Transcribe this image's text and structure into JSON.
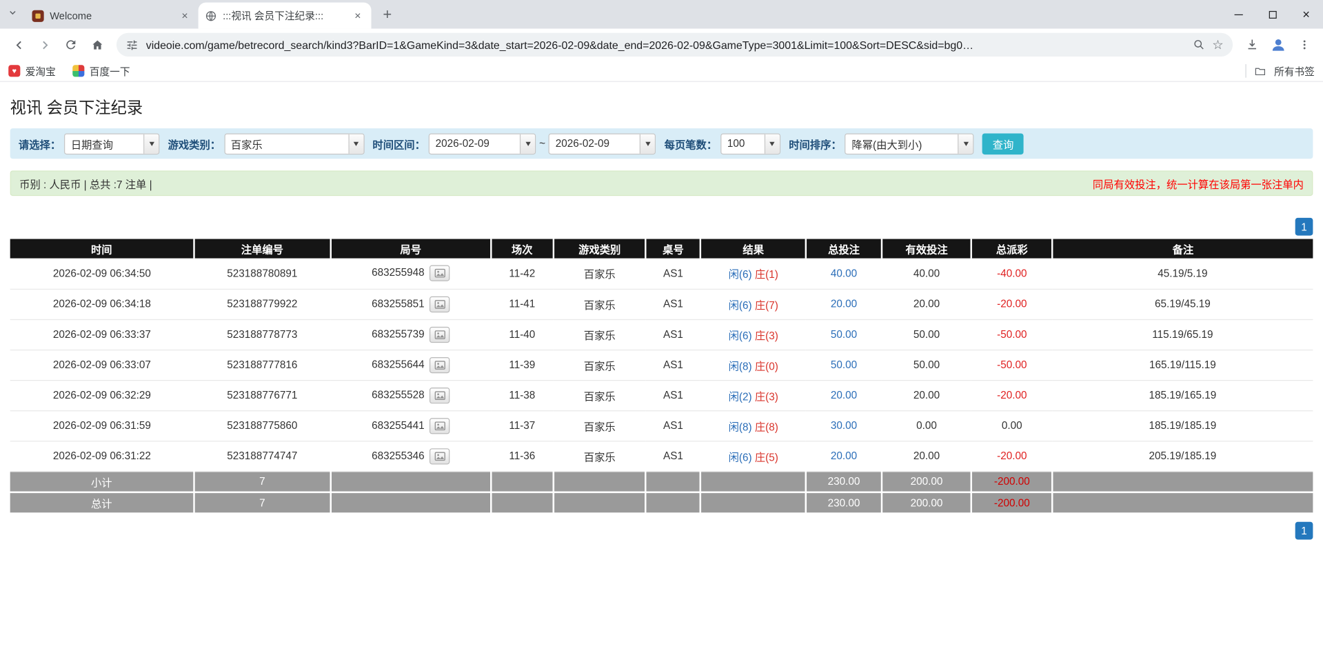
{
  "icons": {
    "close_glyph": "×",
    "plus_glyph": "+",
    "star_glyph": "☆",
    "heart_glyph": "♥"
  },
  "browser": {
    "tabs": [
      {
        "title": "Welcome"
      },
      {
        "title": ":::视讯 会员下注纪录:::"
      }
    ],
    "url": "videoie.com/game/betrecord_search/kind3?BarID=1&GameKind=3&date_start=2026-02-09&date_end=2026-02-09&GameType=3001&Limit=100&Sort=DESC&sid=bg0…",
    "bookmarks": [
      {
        "label": "爱淘宝"
      },
      {
        "label": "百度一下"
      }
    ],
    "all_bookmarks_label": "所有书签"
  },
  "page": {
    "title": "视讯 会员下注纪录",
    "filters": {
      "select_label": "请选择：",
      "select_value": "日期查询",
      "game_label": "游戏类别：",
      "game_value": "百家乐",
      "range_label": "时间区间：",
      "date_start": "2026-02-09",
      "range_separator": "~",
      "date_end": "2026-02-09",
      "per_page_label": "每页笔数：",
      "per_page_value": "100",
      "sort_label": "时间排序：",
      "sort_value": "降幂(由大到小)",
      "search_button": "查询"
    },
    "info_bar": {
      "left": "币别 : 人民币 | 总共 :7 注单 |",
      "right": "同局有效投注，统一计算在该局第一张注单内"
    },
    "pagination": "1",
    "table": {
      "headers": [
        "时间",
        "注单编号",
        "局号",
        "场次",
        "游戏类别",
        "桌号",
        "结果",
        "总投注",
        "有效投注",
        "总派彩",
        "备注"
      ],
      "rows": [
        {
          "time": "2026-02-09 06:34:50",
          "bet_id": "523188780891",
          "round": "683255948",
          "session": "11-42",
          "game": "百家乐",
          "table_no": "AS1",
          "result_player": "闲(6)",
          "result_banker": "庄(1)",
          "total_bet": "40.00",
          "valid_bet": "40.00",
          "payout": "-40.00",
          "remark": "45.19/5.19"
        },
        {
          "time": "2026-02-09 06:34:18",
          "bet_id": "523188779922",
          "round": "683255851",
          "session": "11-41",
          "game": "百家乐",
          "table_no": "AS1",
          "result_player": "闲(6)",
          "result_banker": "庄(7)",
          "total_bet": "20.00",
          "valid_bet": "20.00",
          "payout": "-20.00",
          "remark": "65.19/45.19"
        },
        {
          "time": "2026-02-09 06:33:37",
          "bet_id": "523188778773",
          "round": "683255739",
          "session": "11-40",
          "game": "百家乐",
          "table_no": "AS1",
          "result_player": "闲(6)",
          "result_banker": "庄(3)",
          "total_bet": "50.00",
          "valid_bet": "50.00",
          "payout": "-50.00",
          "remark": "115.19/65.19"
        },
        {
          "time": "2026-02-09 06:33:07",
          "bet_id": "523188777816",
          "round": "683255644",
          "session": "11-39",
          "game": "百家乐",
          "table_no": "AS1",
          "result_player": "闲(8)",
          "result_banker": "庄(0)",
          "total_bet": "50.00",
          "valid_bet": "50.00",
          "payout": "-50.00",
          "remark": "165.19/115.19"
        },
        {
          "time": "2026-02-09 06:32:29",
          "bet_id": "523188776771",
          "round": "683255528",
          "session": "11-38",
          "game": "百家乐",
          "table_no": "AS1",
          "result_player": "闲(2)",
          "result_banker": "庄(3)",
          "total_bet": "20.00",
          "valid_bet": "20.00",
          "payout": "-20.00",
          "remark": "185.19/165.19"
        },
        {
          "time": "2026-02-09 06:31:59",
          "bet_id": "523188775860",
          "round": "683255441",
          "session": "11-37",
          "game": "百家乐",
          "table_no": "AS1",
          "result_player": "闲(8)",
          "result_banker": "庄(8)",
          "total_bet": "30.00",
          "valid_bet": "0.00",
          "payout": "0.00",
          "remark": "185.19/185.19"
        },
        {
          "time": "2026-02-09 06:31:22",
          "bet_id": "523188774747",
          "round": "683255346",
          "session": "11-36",
          "game": "百家乐",
          "table_no": "AS1",
          "result_player": "闲(6)",
          "result_banker": "庄(5)",
          "total_bet": "20.00",
          "valid_bet": "20.00",
          "payout": "-20.00",
          "remark": "205.19/185.19"
        }
      ],
      "subtotal": {
        "label": "小计",
        "count": "7",
        "total_bet": "230.00",
        "valid_bet": "200.00",
        "payout": "-200.00"
      },
      "total": {
        "label": "总计",
        "count": "7",
        "total_bet": "230.00",
        "valid_bet": "200.00",
        "payout": "-200.00"
      }
    },
    "colors": {
      "search_button": "#2fb4ca",
      "pagination_blue": "#2478bd",
      "table_header_bg": "#151515",
      "filter_bar_bg": "#d9edf7",
      "info_bar_bg": "#dff0d8",
      "notice_red": "#ff0000",
      "bet_link_blue": "#2a6db8",
      "player_blue": "#2a6db8",
      "banker_red": "#d9342b",
      "loss_red": "#e02020",
      "summary_row_bg": "#9a9a9a"
    }
  }
}
